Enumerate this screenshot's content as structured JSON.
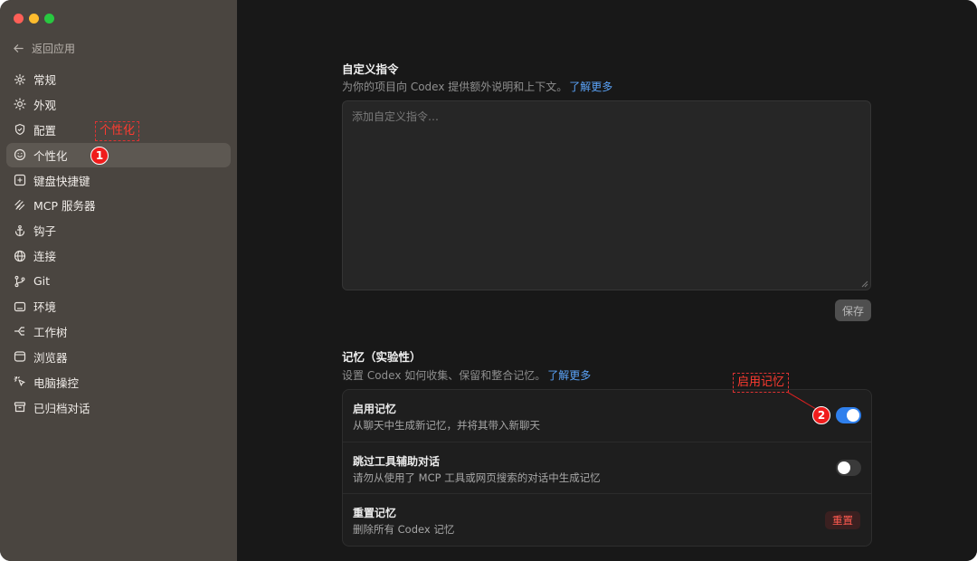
{
  "window": {
    "traffic_lights": [
      "close",
      "minimize",
      "zoom"
    ]
  },
  "sidebar": {
    "back_label": "返回应用",
    "items": [
      {
        "label": "常规",
        "icon": "gear-icon"
      },
      {
        "label": "外观",
        "icon": "sun-icon"
      },
      {
        "label": "配置",
        "icon": "shield-icon"
      },
      {
        "label": "个性化",
        "icon": "smile-icon",
        "active": true
      },
      {
        "label": "键盘快捷键",
        "icon": "keyboard-icon"
      },
      {
        "label": "MCP 服务器",
        "icon": "mcp-icon"
      },
      {
        "label": "钩子",
        "icon": "anchor-icon"
      },
      {
        "label": "连接",
        "icon": "globe-icon"
      },
      {
        "label": "Git",
        "icon": "branch-icon"
      },
      {
        "label": "环境",
        "icon": "monitor-icon"
      },
      {
        "label": "工作树",
        "icon": "tree-icon"
      },
      {
        "label": "浏览器",
        "icon": "browser-icon"
      },
      {
        "label": "电脑操控",
        "icon": "pointer-icon"
      },
      {
        "label": "已归档对话",
        "icon": "archive-icon"
      }
    ]
  },
  "annotations": {
    "a1_label": "个性化",
    "a1_number": "1",
    "a2_label": "启用记忆",
    "a2_number": "2"
  },
  "custom_instructions": {
    "title": "自定义指令",
    "desc": "为你的项目向 Codex 提供额外说明和上下文。",
    "link": "了解更多",
    "placeholder": "添加自定义指令…",
    "save_label": "保存"
  },
  "memory": {
    "title": "记忆（实验性）",
    "desc": "设置 Codex 如何收集、保留和整合记忆。",
    "link": "了解更多",
    "rows": [
      {
        "title": "启用记忆",
        "desc": "从聊天中生成新记忆，并将其带入新聊天",
        "enabled": true
      },
      {
        "title": "跳过工具辅助对话",
        "desc": "请勿从使用了 MCP 工具或网页搜索的对话中生成记忆",
        "enabled": false
      },
      {
        "title": "重置记忆",
        "desc": "删除所有 Codex 记忆",
        "button": "重置"
      }
    ]
  },
  "colors": {
    "accent": "#2f80ed",
    "link": "#5aa2f7",
    "danger": "#ff5a4f",
    "annotation": "#f01c1c"
  }
}
